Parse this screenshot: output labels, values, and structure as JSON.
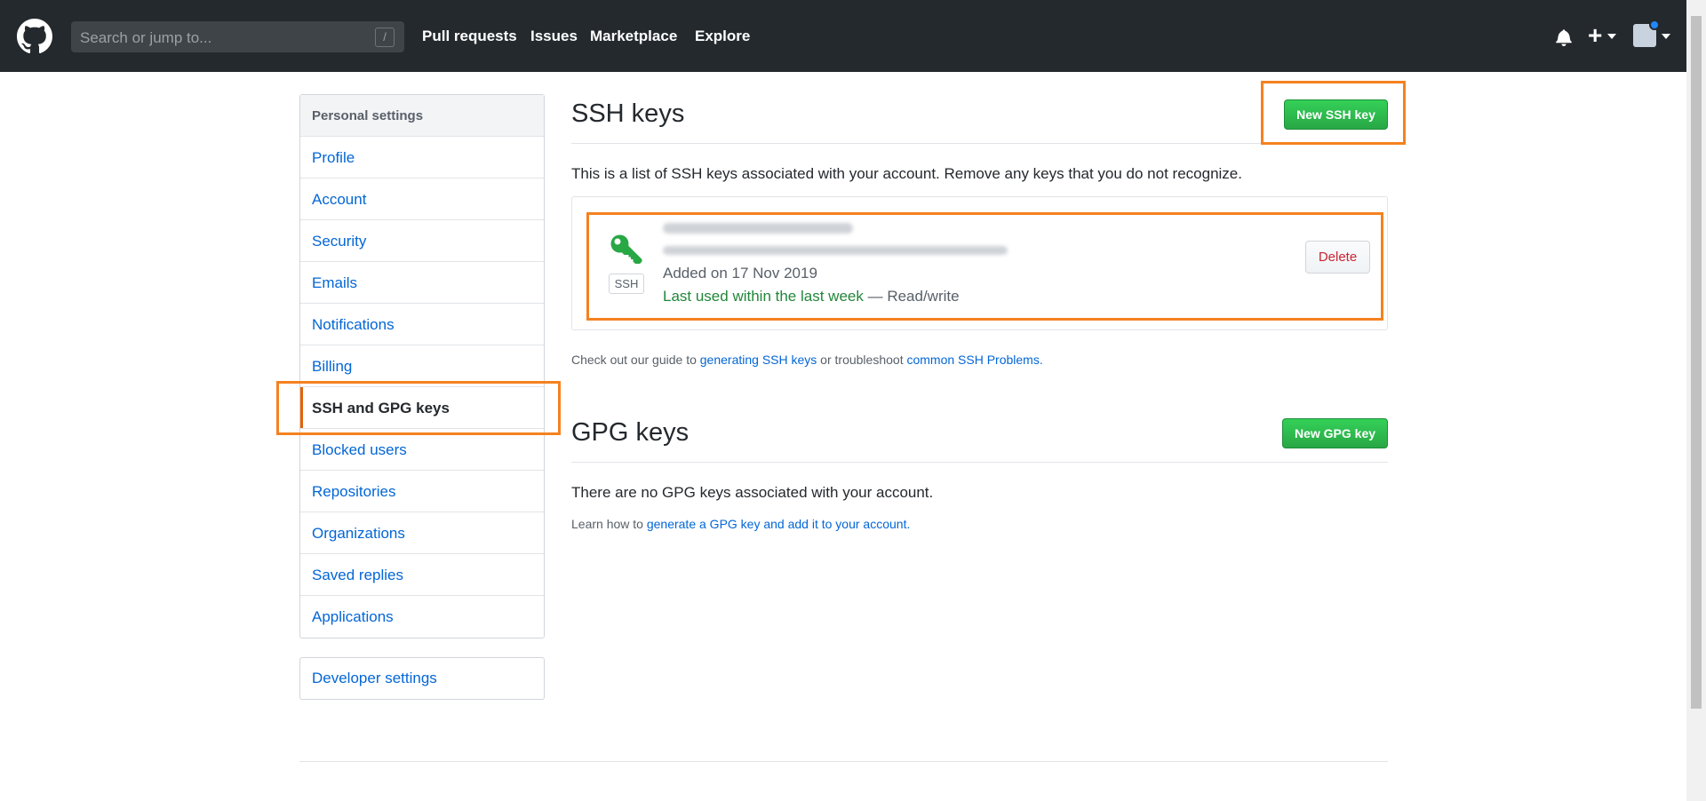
{
  "header": {
    "search_placeholder": "Search or jump to...",
    "slash_hint": "/",
    "nav": [
      "Pull requests",
      "Issues",
      "Marketplace",
      "Explore"
    ],
    "plus_label": "+"
  },
  "sidebar": {
    "title": "Personal settings",
    "items": [
      {
        "label": "Profile"
      },
      {
        "label": "Account"
      },
      {
        "label": "Security"
      },
      {
        "label": "Emails"
      },
      {
        "label": "Notifications"
      },
      {
        "label": "Billing"
      },
      {
        "label": "SSH and GPG keys"
      },
      {
        "label": "Blocked users"
      },
      {
        "label": "Repositories"
      },
      {
        "label": "Organizations"
      },
      {
        "label": "Saved replies"
      },
      {
        "label": "Applications"
      }
    ],
    "developer": "Developer settings"
  },
  "ssh": {
    "title": "SSH keys",
    "new_button": "New SSH key",
    "description": "This is a list of SSH keys associated with your account. Remove any keys that you do not recognize.",
    "key": {
      "badge": "SSH",
      "added": "Added on 17 Nov 2019",
      "last_used": "Last used within the last week",
      "access": "— Read/write",
      "delete_label": "Delete"
    },
    "guide_prefix": "Check out our guide to ",
    "guide_link1": "generating SSH keys",
    "guide_middle": " or troubleshoot ",
    "guide_link2": "common SSH Problems",
    "guide_suffix": "."
  },
  "gpg": {
    "title": "GPG keys",
    "new_button": "New GPG key",
    "empty": "There are no GPG keys associated with your account.",
    "learn_prefix": "Learn how to ",
    "learn_link": "generate a GPG key and add it to your account",
    "learn_suffix": "."
  },
  "colors": {
    "header_bg": "#24292e",
    "link": "#0366d6",
    "green": "#28a745",
    "highlight": "#f5821f",
    "danger": "#cb2431"
  }
}
